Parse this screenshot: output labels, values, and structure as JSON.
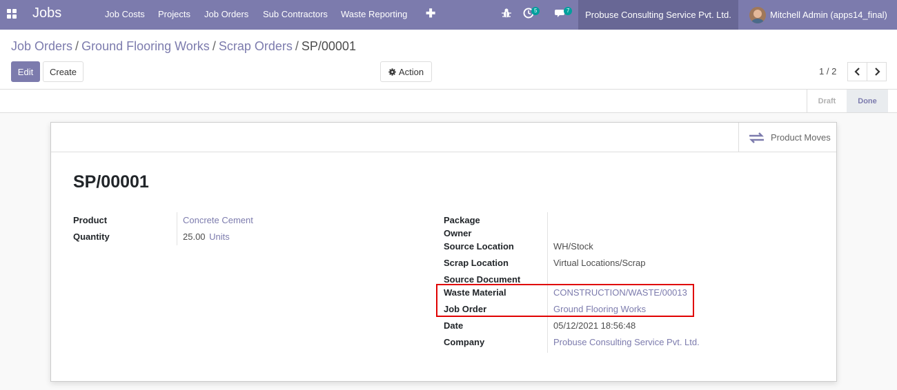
{
  "navbar": {
    "app_title": "Jobs",
    "menu": [
      "Job Costs",
      "Projects",
      "Job Orders",
      "Sub Contractors",
      "Waste Reporting"
    ],
    "activity_badge": "5",
    "messages_badge": "7",
    "company": "Probuse Consulting Service Pvt. Ltd.",
    "user": "Mitchell Admin (apps14_final)",
    "accent_color": "#7c7bad"
  },
  "breadcrumb": {
    "items": [
      "Job Orders",
      "Ground Flooring Works",
      "Scrap Orders"
    ],
    "separator": "/",
    "current": "SP/00001"
  },
  "toolbar": {
    "edit_label": "Edit",
    "create_label": "Create",
    "action_label": "Action"
  },
  "pager": {
    "value": "1 / 2"
  },
  "status": {
    "stages": [
      "Draft",
      "Done"
    ],
    "active": "Done"
  },
  "sheet": {
    "stat_button_label": "Product Moves",
    "title": "SP/00001",
    "left_fields": {
      "product_label": "Product",
      "product_value": "Concrete Cement",
      "quantity_label": "Quantity",
      "quantity_value": "25.00",
      "quantity_uom": "Units"
    },
    "right_fields": {
      "package_label": "Package",
      "owner_label": "Owner",
      "source_location_label": "Source Location",
      "source_location_value": "WH/Stock",
      "scrap_location_label": "Scrap Location",
      "scrap_location_value": "Virtual Locations/Scrap",
      "source_document_label": "Source Document",
      "waste_material_label": "Waste Material",
      "waste_material_value": "CONSTRUCTION/WASTE/00013",
      "job_order_label": "Job Order",
      "job_order_value": "Ground Flooring Works",
      "date_label": "Date",
      "date_value": "05/12/2021 18:56:48",
      "company_label": "Company",
      "company_value": "Probuse Consulting Service Pvt. Ltd."
    }
  }
}
